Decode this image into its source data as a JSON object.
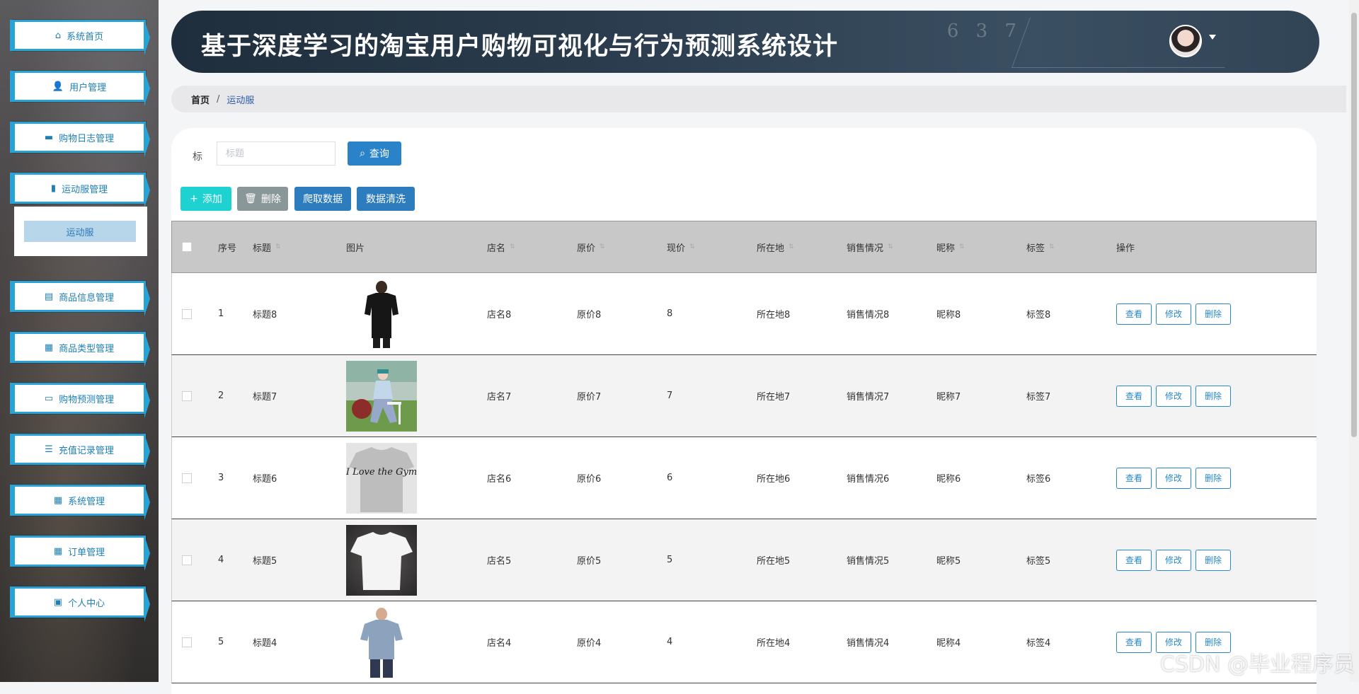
{
  "app": {
    "title": "基于深度学习的淘宝用户购物可视化与行为预测系统设计",
    "watermark": "CSDN @毕业程序员"
  },
  "sidebar": {
    "items": [
      {
        "label": "系统首页",
        "icon": "home-icon"
      },
      {
        "label": "用户管理",
        "icon": "user-icon"
      },
      {
        "label": "购物日志管理",
        "icon": "monitor-icon"
      },
      {
        "label": "运动服管理",
        "icon": "chart-icon"
      },
      {
        "label": "商品信息管理",
        "icon": "clipboard-icon"
      },
      {
        "label": "商品类型管理",
        "icon": "grid-icon"
      },
      {
        "label": "购物预测管理",
        "icon": "chat-icon"
      },
      {
        "label": "充值记录管理",
        "icon": "sliders-icon"
      },
      {
        "label": "系统管理",
        "icon": "grid-icon"
      },
      {
        "label": "订单管理",
        "icon": "grid-icon"
      },
      {
        "label": "个人中心",
        "icon": "card-icon"
      }
    ],
    "submenu": [
      "运动服"
    ]
  },
  "breadcrumb": {
    "home": "首页",
    "sep": "/",
    "current": "运动服"
  },
  "search": {
    "label": "标",
    "placeholder": "标题",
    "value": "",
    "button": "查询"
  },
  "toolbar": {
    "add": "添加",
    "delete": "删除",
    "crawl": "爬取数据",
    "clean": "数据清洗"
  },
  "table": {
    "headers": [
      "序号",
      "标题",
      "图片",
      "店名",
      "原价",
      "现价",
      "所在地",
      "销售情况",
      "昵称",
      "标签",
      "操作"
    ],
    "rows": [
      {
        "no": "1",
        "title": "标题8",
        "shop": "店名8",
        "orig": "原价8",
        "price": "8",
        "loc": "所在地8",
        "sales": "销售情况8",
        "nick": "昵称8",
        "tag": "标签8",
        "img": "black-tshirt"
      },
      {
        "no": "2",
        "title": "标题7",
        "shop": "店名7",
        "orig": "原价7",
        "price": "7",
        "loc": "所在地7",
        "sales": "销售情况7",
        "nick": "昵称7",
        "tag": "标签7",
        "img": "girl-outdoor"
      },
      {
        "no": "3",
        "title": "标题6",
        "shop": "店名6",
        "orig": "原价6",
        "price": "6",
        "loc": "所在地6",
        "sales": "销售情况6",
        "nick": "昵称6",
        "tag": "标签6",
        "img": "gray-tshirt-print"
      },
      {
        "no": "4",
        "title": "标题5",
        "shop": "店名5",
        "orig": "原价5",
        "price": "5",
        "loc": "所在地5",
        "sales": "销售情况5",
        "nick": "昵称5",
        "tag": "标签5",
        "img": "white-tshirt"
      },
      {
        "no": "5",
        "title": "标题4",
        "shop": "店名4",
        "orig": "原价4",
        "price": "4",
        "loc": "所在地4",
        "sales": "销售情况4",
        "nick": "昵称4",
        "tag": "标签4",
        "img": "blue-polo"
      }
    ],
    "actions": {
      "view": "查看",
      "edit": "修改",
      "delete": "删除"
    },
    "print_text": "I Love the Gym"
  },
  "colors": {
    "accent": "#2a82c9",
    "menu_border": "#27a3d8",
    "add_button": "#1fd2d2",
    "delete_button": "#8a9798"
  }
}
